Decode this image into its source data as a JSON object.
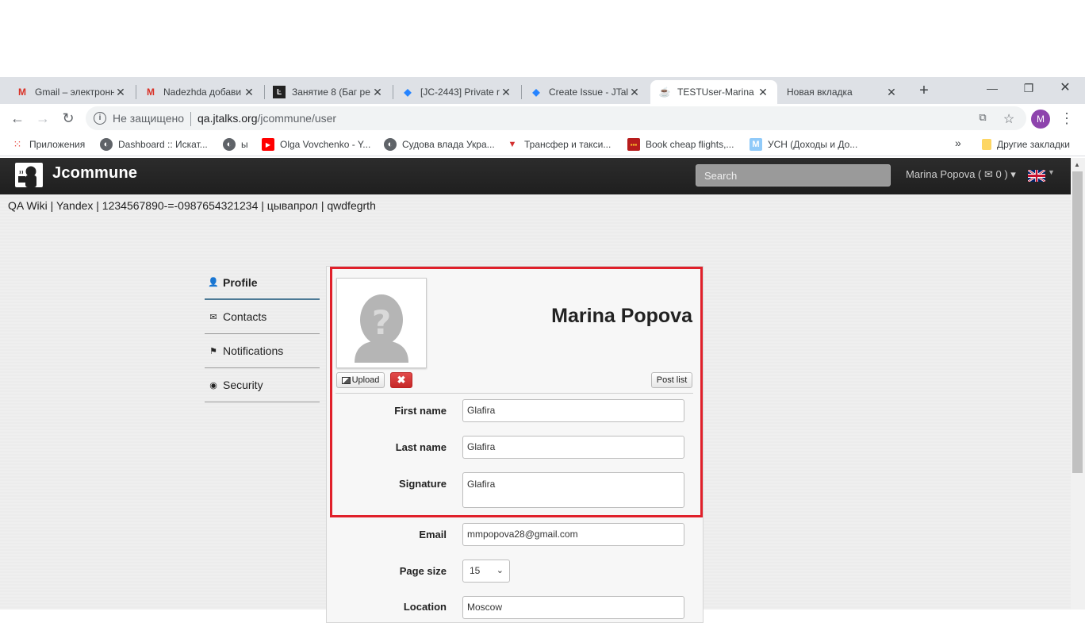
{
  "browser": {
    "tabs": [
      {
        "title": "Gmail – электронн",
        "icon": "gmail-icon"
      },
      {
        "title": "Nadezhda добави",
        "icon": "gmail-icon"
      },
      {
        "title": "Занятие 8 (Баг ре",
        "icon": "lesson-icon"
      },
      {
        "title": "[JC-2443] Private r",
        "icon": "jira-icon"
      },
      {
        "title": "Create Issue - JTalk",
        "icon": "jira-icon"
      },
      {
        "title": "TESTUser-Marina P",
        "icon": "coffee-icon"
      },
      {
        "title": "Новая вкладка",
        "icon": ""
      }
    ],
    "new_tab": "+",
    "insecure_label": "Не защищено",
    "url_host": "qa.jtalks.org",
    "url_path": "/jcommune/user",
    "profile_initial": "M",
    "bookmarks": [
      {
        "label": "Приложения",
        "icon": "apps-icon"
      },
      {
        "label": "Dashboard :: Искат...",
        "icon": "globe-icon"
      },
      {
        "label": "ы",
        "icon": "globe-icon"
      },
      {
        "label": "Olga Vovchenko - Y...",
        "icon": "youtube-icon"
      },
      {
        "label": "Судова влада Укра...",
        "icon": "globe-icon"
      },
      {
        "label": "Трансфер и такси...",
        "icon": "transfer-icon"
      },
      {
        "label": "Book cheap flights,...",
        "icon": "flights-icon"
      },
      {
        "label": "УСН (Доходы и До...",
        "icon": "m-icon"
      }
    ],
    "other_bookmarks": "Другие закладки",
    "overflow": "»"
  },
  "site": {
    "logo": "Jcommune",
    "search_placeholder": "Search",
    "user_menu": "Marina Popova ( ✉ 0 ) ▾",
    "links": "QA Wiki | Yandex | 1234567890-=-0987654321234 | цывапрол | qwdfegrth"
  },
  "sidemenu": [
    {
      "label": "Profile",
      "icon": "user-icon"
    },
    {
      "label": "Contacts",
      "icon": "envelope-icon"
    },
    {
      "label": "Notifications",
      "icon": "flag-icon"
    },
    {
      "label": "Security",
      "icon": "eye-slash-icon"
    }
  ],
  "profile": {
    "full_name": "Marina Popova",
    "upload_label": "Upload",
    "remove_label": "✖",
    "post_list_label": "Post list",
    "fields": {
      "first_name": {
        "label": "First name",
        "value": "Glafira"
      },
      "last_name": {
        "label": "Last name",
        "value": "Glafira"
      },
      "signature": {
        "label": "Signature",
        "value": "Glafira"
      },
      "email": {
        "label": "Email",
        "value": "mmpopova28@gmail.com"
      },
      "page_size": {
        "label": "Page size",
        "value": "15"
      },
      "location": {
        "label": "Location",
        "value": "Moscow"
      }
    }
  },
  "colors": {
    "highlight": "#e0202a",
    "navbar": "#222222",
    "active_tab_underline": "#4d7a96"
  }
}
